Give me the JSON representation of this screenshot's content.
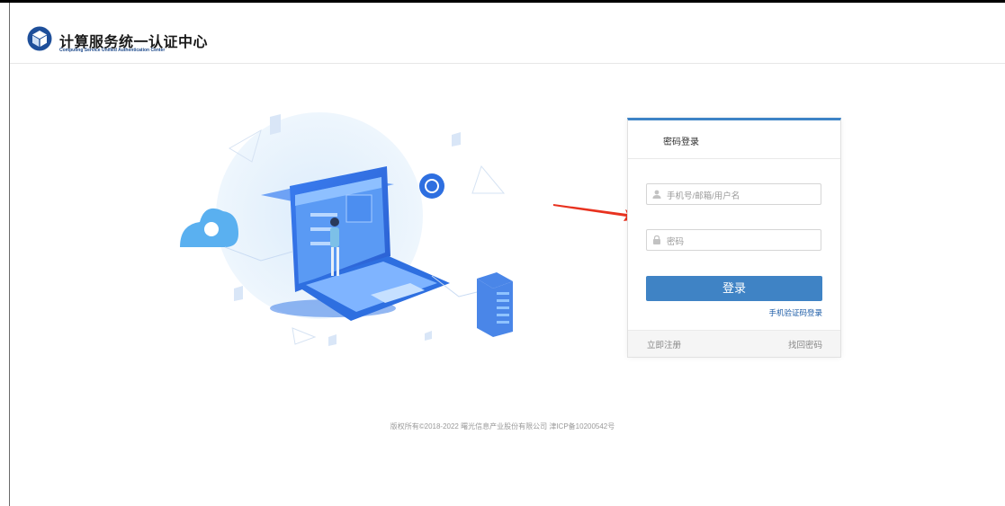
{
  "brand": {
    "title": "计算服务统一认证中心",
    "subtitle": "Computing Service Unified Authentication Center"
  },
  "login": {
    "tab_label": "密码登录",
    "username_placeholder": "手机号/邮箱/用户名",
    "password_placeholder": "密码",
    "submit_label": "登录",
    "sms_login_label": "手机验证码登录",
    "register_label": "立即注册",
    "forgot_label": "找回密码"
  },
  "footer": {
    "copyright": "版权所有©2018-2022  曙光信息产业股份有限公司  津ICP备10200542号"
  },
  "colors": {
    "accent": "#3d83c6",
    "button": "#3f83c5",
    "arrow": "#e8321f"
  },
  "icons": {
    "logo": "cube-logo-icon",
    "username": "user-icon",
    "password": "lock-icon",
    "annotation": "red-arrow-icon"
  }
}
